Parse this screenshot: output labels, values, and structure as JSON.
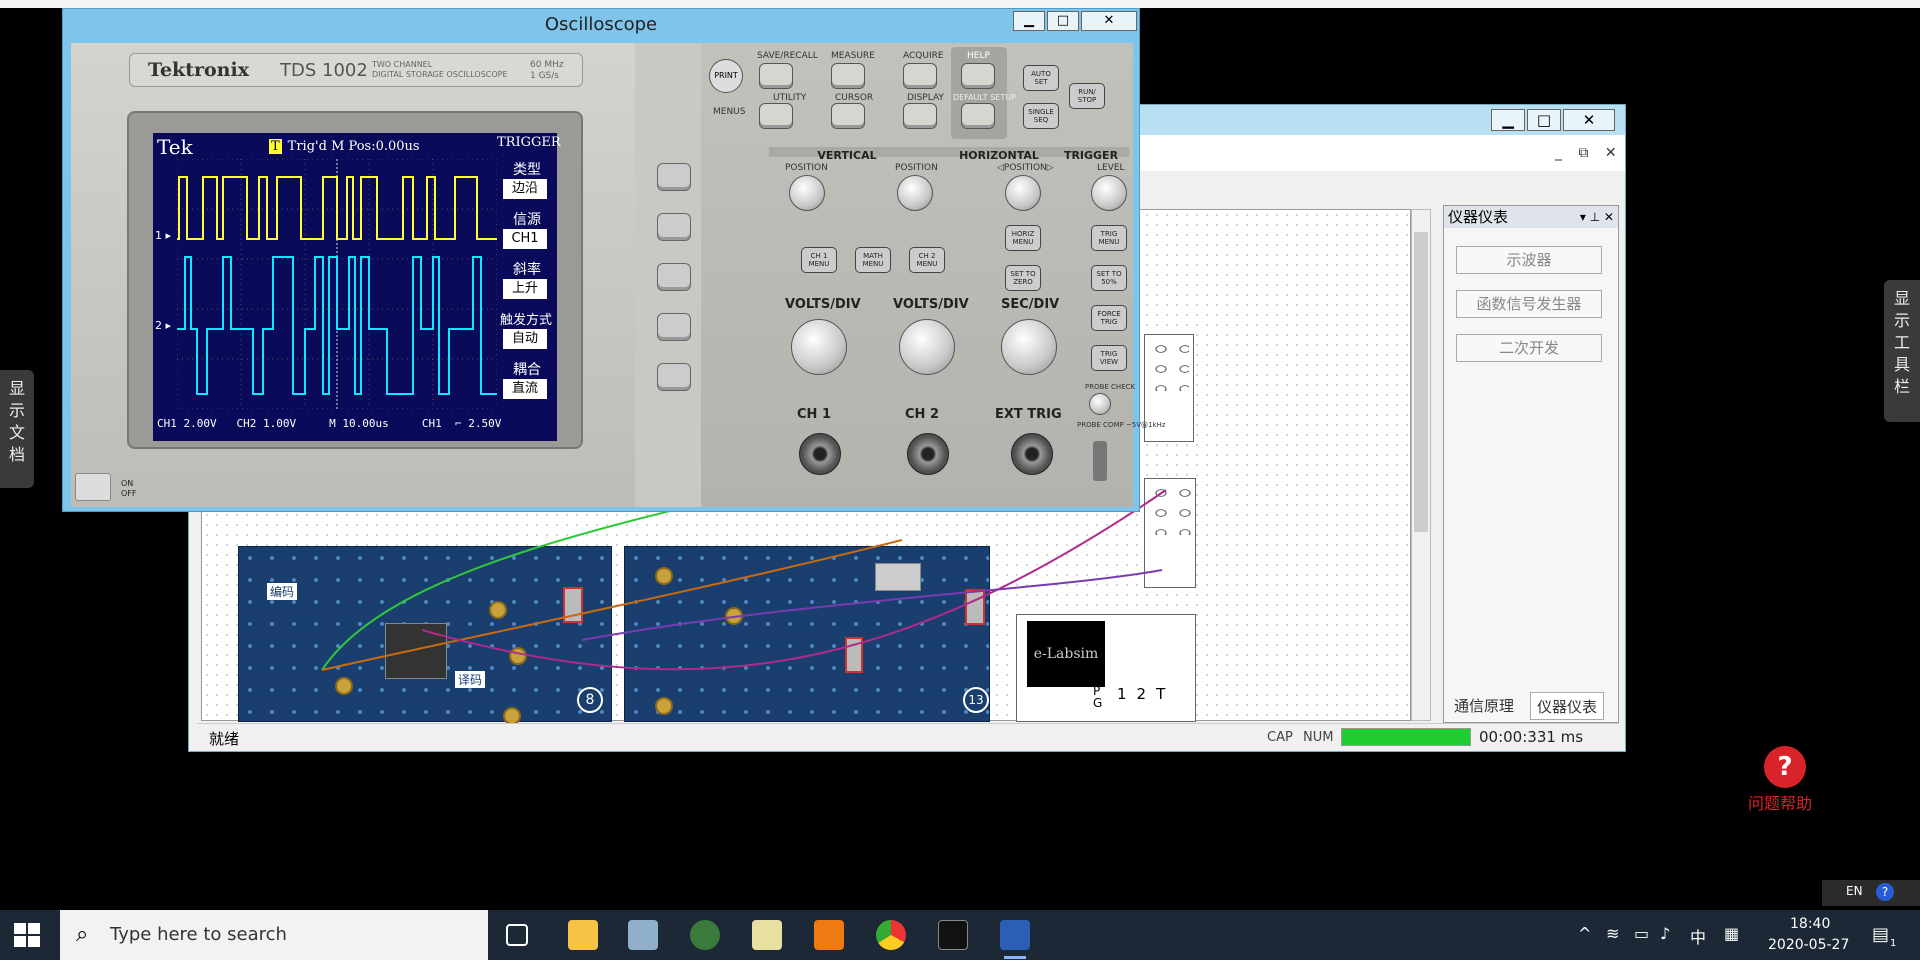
{
  "side_tabs": {
    "documents": "显示文档",
    "toolbar": "显示工具栏"
  },
  "back_window": {
    "controls": {
      "minimize": "▁",
      "maximize": "□",
      "close": "✕"
    },
    "inner_controls": "_ ⧉ ✕",
    "panel": {
      "title": "仪器仪表",
      "buttons": [
        "示波器",
        "函数信号发生器",
        "二次开发"
      ],
      "tabs": [
        "通信原理",
        "仪器仪表"
      ]
    },
    "status": {
      "text": "就绪",
      "cap": "CAP",
      "num": "NUM",
      "progress": 1.0,
      "timer": "00:00:331 ms"
    },
    "boards": {
      "encode_label": "编码",
      "decode_label": "译码",
      "module_8": "8",
      "module_13": "13",
      "elabsim": "e-Labsim"
    },
    "terminal_labels": [
      "1",
      "2",
      "T"
    ],
    "terminal_pg": "P G"
  },
  "oscilloscope": {
    "title": "Oscilloscope",
    "controls": {
      "minimize": "▁",
      "maximize": "□",
      "close": "✕"
    },
    "brand": "Tektronix",
    "model": "TDS 1002",
    "model_sub": "TWO CHANNEL\nDIGITAL STORAGE OSCILLOSCOPE",
    "spec": "60 MHz\n1 GS/s",
    "screen": {
      "logo": "Tek",
      "status": "Trig'd  M Pos:0.00us",
      "trigger_title": "TRIGGER",
      "menu": [
        {
          "label": "类型",
          "value": "边沿"
        },
        {
          "label": "信源",
          "value": "CH1"
        },
        {
          "label": "斜率",
          "value": "上升"
        },
        {
          "label": "触发方式",
          "value": "自动"
        },
        {
          "label": "耦合",
          "value": "直流"
        }
      ],
      "footer": "CH1 2.00V   CH2 1.00V     M 10.00us     CH1  ⌐ 2.50V",
      "ch1_marker": "1 ▸",
      "ch2_marker": "2 ▸"
    },
    "power": "ON\nOFF",
    "panel": {
      "top_labels": [
        "SAVE/RECALL",
        "MEASURE",
        "ACQUIRE",
        "HELP",
        "UTILITY",
        "CURSOR",
        "DISPLAY",
        "DEFAULT SETUP"
      ],
      "print": "PRINT",
      "menus": "MENUS",
      "autoset": "AUTO SET",
      "run_stop": "RUN/ STOP",
      "single_seq": "SINGLE SEQ",
      "sections": [
        "VERTICAL",
        "HORIZONTAL",
        "TRIGGER"
      ],
      "position_labels": [
        "POSITION",
        "POSITION",
        "◁POSITION▷",
        "LEVEL"
      ],
      "menu_buttons": [
        "CH 1 MENU",
        "MATH MENU",
        "CH 2 MENU"
      ],
      "horiz_buttons": [
        "HORIZ MENU",
        "SET TO ZERO"
      ],
      "trig_buttons": [
        "TRIG MENU",
        "SET TO 50%",
        "FORCE TRIG",
        "TRIG VIEW"
      ],
      "div_labels": [
        "VOLTS/DIV",
        "VOLTS/DIV",
        "SEC/DIV"
      ],
      "inputs": [
        "CH 1",
        "CH 2",
        "EXT TRIG"
      ],
      "probe_check": "PROBE CHECK",
      "probe_comp": "PROBE COMP ~5V@1kHz"
    }
  },
  "help": {
    "icon": "?",
    "label": "问题帮助"
  },
  "taskbar": {
    "search_placeholder": "Type here to search",
    "time": "18:40",
    "date": "2020-05-27",
    "ime_lang": "中",
    "ime_en": "EN",
    "notification_count": "1"
  },
  "colors": {
    "ch1": "#ffff30",
    "ch2": "#10e8ff",
    "screen_bg": "#0a0a5a",
    "title_bar": "#7fc4ea"
  }
}
